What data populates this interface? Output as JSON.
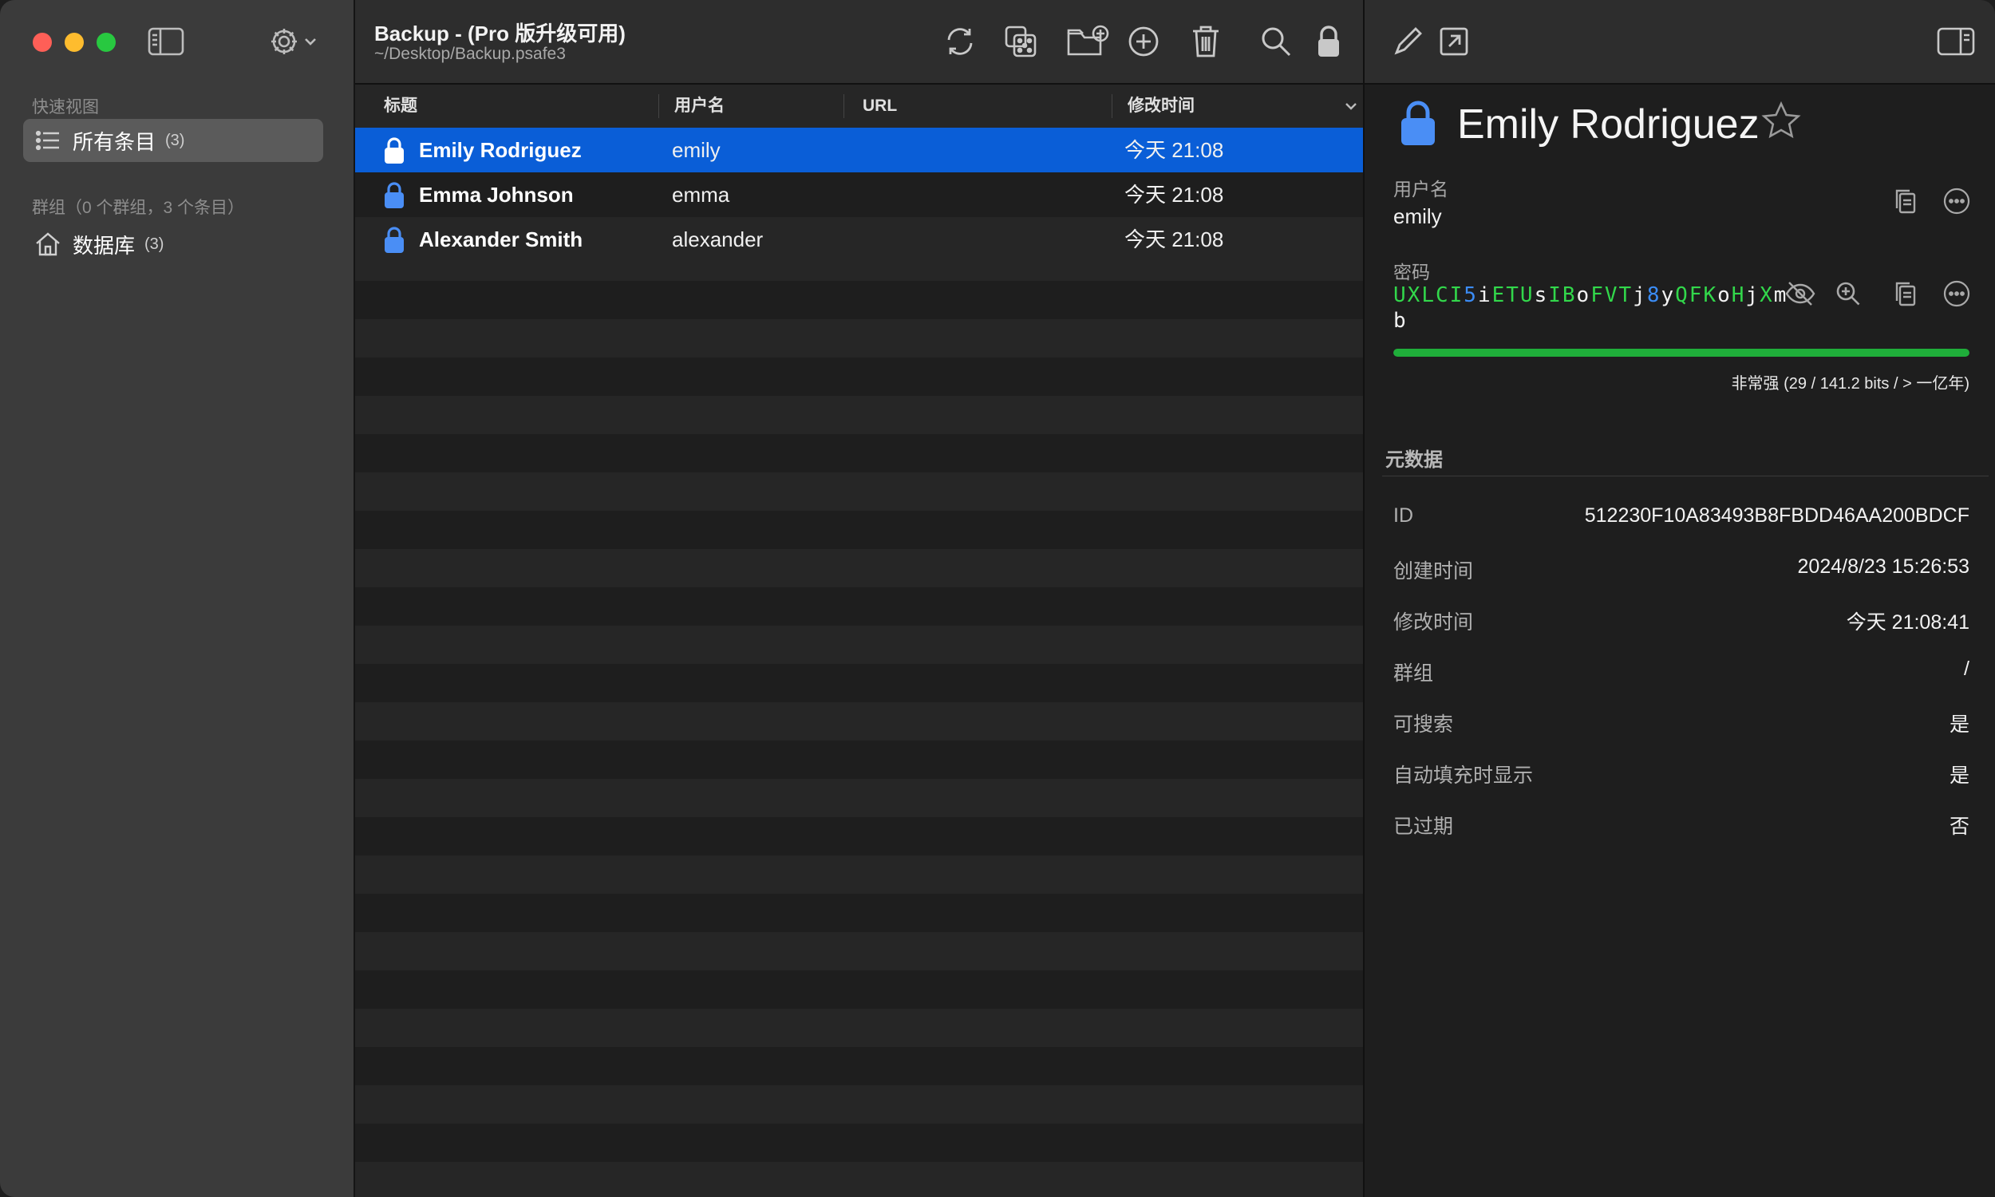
{
  "colors": {
    "selection": "#0a5ed7",
    "lock_blue": "#4a8ef5",
    "strength_green": "#1fae3a",
    "pw_uppercase": "#32d74b",
    "pw_digit": "#3b8cf5"
  },
  "sidebar": {
    "quick_view_heading": "快速视图",
    "all_items": {
      "label": "所有条目",
      "count": "(3)",
      "icon": "list-icon"
    },
    "groups_heading": "群组（0 个群组，3 个条目）",
    "database": {
      "label": "数据库",
      "count": "(3)",
      "icon": "home-icon"
    }
  },
  "window": {
    "title": "Backup - (Pro 版升级可用)",
    "subtitle": "~/Desktop/Backup.psafe3"
  },
  "toolbar": {
    "icons": [
      "sync-icon",
      "dice-icon",
      "new-folder-icon",
      "add-icon",
      "trash-icon",
      "search-icon",
      "lock-icon"
    ]
  },
  "columns": {
    "title": "标题",
    "username": "用户名",
    "url": "URL",
    "modified": "修改时间"
  },
  "entries": [
    {
      "title": "Emily Rodriguez",
      "username": "emily",
      "url": "",
      "modified": "今天 21:08",
      "selected": true
    },
    {
      "title": "Emma Johnson",
      "username": "emma",
      "url": "",
      "modified": "今天 21:08",
      "selected": false
    },
    {
      "title": "Alexander Smith",
      "username": "alexander",
      "url": "",
      "modified": "今天 21:08",
      "selected": false
    }
  ],
  "detail": {
    "title": "Emily Rodriguez",
    "username_label": "用户名",
    "username": "emily",
    "password_label": "密码",
    "password": "UXLCI5iETUsIBoFVTj8yQFKoHjXmb",
    "strength_fraction": 1.0,
    "strength_text": "非常强 (29 / 141.2 bits / > 一亿年)",
    "metadata_title": "元数据",
    "metadata": [
      {
        "key": "ID",
        "value": "512230F10A83493B8FBDD46AA200BDCF"
      },
      {
        "key": "创建时间",
        "value": "2024/8/23 15:26:53"
      },
      {
        "key": "修改时间",
        "value": "今天 21:08:41"
      },
      {
        "key": "群组",
        "value": "/"
      },
      {
        "key": "可搜索",
        "value": "是"
      },
      {
        "key": "自动填充时显示",
        "value": "是"
      },
      {
        "key": "已过期",
        "value": "否"
      }
    ]
  }
}
